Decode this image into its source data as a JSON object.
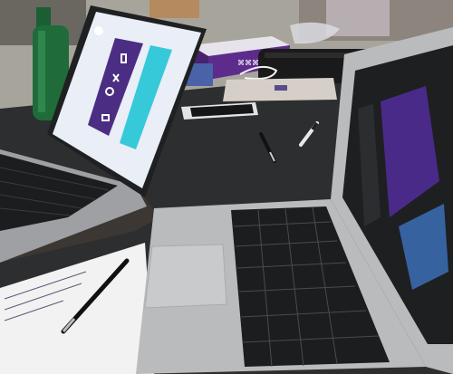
{
  "scene": {
    "objects": {
      "left_laptop": "laptop",
      "right_laptop": "laptop",
      "bottle": "green-bottle",
      "boxes": "product-boxes",
      "pouch": "black-pouch",
      "envelope": "envelope",
      "phone": "phone",
      "pen_on_notebook": "pen",
      "pen_table_1": "pen",
      "pen_table_2": "pen",
      "notebook": "notebook"
    },
    "box_label": "⌘⌘⌘",
    "colors": {
      "table": "#2d2e30",
      "floor": "#a7a49b",
      "laptop_silver": "#b9bbbd",
      "screen_bg_left": "#e9eef7",
      "screen_purple": "#4b2e83",
      "screen_cyan": "#36c9d9",
      "right_screen_purple": "#4a2a88",
      "bottle_green": "#1f6b3a",
      "notebook_white": "#f2f2f2",
      "keyboard_black": "#1c1d1f",
      "box_purple": "#5c2b8c"
    },
    "icons": [
      "mobile-icon",
      "lock-icon",
      "bulb-icon",
      "scissors-icon"
    ]
  }
}
